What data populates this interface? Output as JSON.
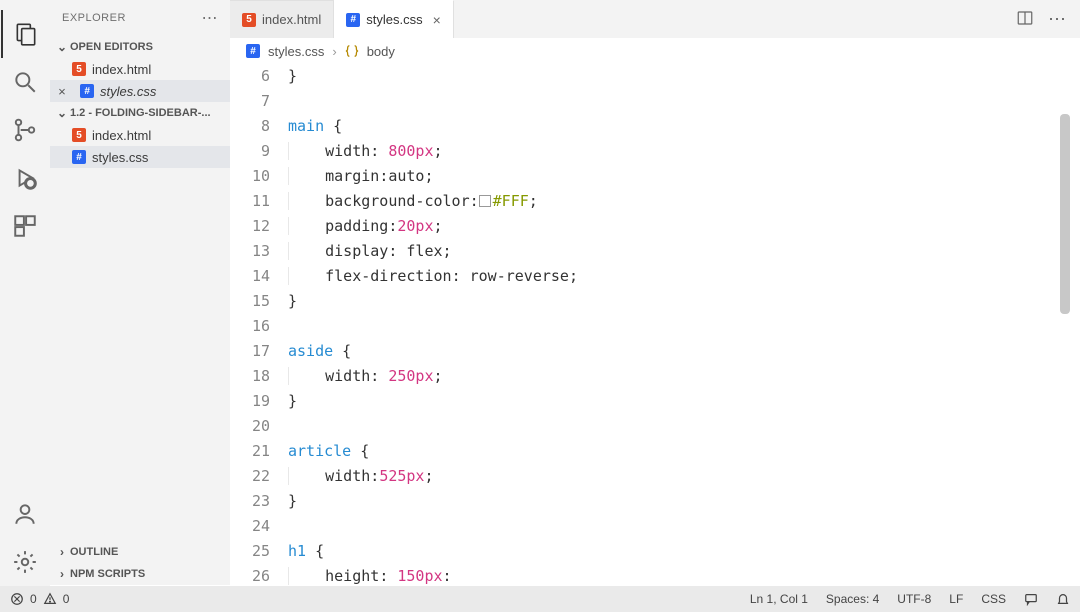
{
  "sidebar": {
    "title": "EXPLORER",
    "openEditors": {
      "label": "OPEN EDITORS",
      "items": [
        {
          "name": "index.html",
          "type": "html",
          "dirty": false,
          "active": false
        },
        {
          "name": "styles.css",
          "type": "css",
          "dirty": true,
          "active": true
        }
      ]
    },
    "workspace": {
      "label": "1.2 - FOLDING-SIDEBAR-...",
      "items": [
        {
          "name": "index.html",
          "type": "html",
          "active": false
        },
        {
          "name": "styles.css",
          "type": "css",
          "active": true
        }
      ]
    },
    "outline": "OUTLINE",
    "npmScripts": "NPM SCRIPTS"
  },
  "tabs": [
    {
      "name": "index.html",
      "type": "html",
      "active": false,
      "closeable": false
    },
    {
      "name": "styles.css",
      "type": "css",
      "active": true,
      "closeable": true
    }
  ],
  "breadcrumb": {
    "file": "styles.css",
    "symbol": "body"
  },
  "editor": {
    "startLine": 6,
    "lines": [
      {
        "n": 6,
        "indent": 0,
        "tokens": [
          {
            "t": "}",
            "c": ""
          }
        ]
      },
      {
        "n": 7,
        "indent": 0,
        "tokens": []
      },
      {
        "n": 8,
        "indent": 0,
        "tokens": [
          {
            "t": "main",
            "c": "sel"
          },
          {
            "t": " {",
            "c": ""
          }
        ]
      },
      {
        "n": 9,
        "indent": 1,
        "tokens": [
          {
            "t": "width",
            "c": "prop"
          },
          {
            "t": ": ",
            "c": ""
          },
          {
            "t": "800px",
            "c": "num"
          },
          {
            "t": ";",
            "c": ""
          }
        ]
      },
      {
        "n": 10,
        "indent": 1,
        "tokens": [
          {
            "t": "margin",
            "c": "prop"
          },
          {
            "t": ":",
            "c": ""
          },
          {
            "t": "auto",
            "c": "kw"
          },
          {
            "t": ";",
            "c": ""
          }
        ]
      },
      {
        "n": 11,
        "indent": 1,
        "tokens": [
          {
            "t": "background-color",
            "c": "prop"
          },
          {
            "t": ":",
            "c": ""
          },
          {
            "t": "swatch",
            "c": "SW"
          },
          {
            "t": "#FFF",
            "c": "hex"
          },
          {
            "t": ";",
            "c": ""
          }
        ]
      },
      {
        "n": 12,
        "indent": 1,
        "tokens": [
          {
            "t": "padding",
            "c": "prop"
          },
          {
            "t": ":",
            "c": ""
          },
          {
            "t": "20px",
            "c": "num"
          },
          {
            "t": ";",
            "c": ""
          }
        ]
      },
      {
        "n": 13,
        "indent": 1,
        "tokens": [
          {
            "t": "display",
            "c": "prop"
          },
          {
            "t": ": ",
            "c": ""
          },
          {
            "t": "flex",
            "c": "kw"
          },
          {
            "t": ";",
            "c": ""
          }
        ]
      },
      {
        "n": 14,
        "indent": 1,
        "tokens": [
          {
            "t": "flex-direction",
            "c": "prop"
          },
          {
            "t": ": ",
            "c": ""
          },
          {
            "t": "row-reverse",
            "c": "kw"
          },
          {
            "t": ";",
            "c": ""
          }
        ]
      },
      {
        "n": 15,
        "indent": 0,
        "tokens": [
          {
            "t": "}",
            "c": ""
          }
        ]
      },
      {
        "n": 16,
        "indent": 0,
        "tokens": []
      },
      {
        "n": 17,
        "indent": 0,
        "tokens": [
          {
            "t": "aside",
            "c": "sel"
          },
          {
            "t": " {",
            "c": ""
          }
        ]
      },
      {
        "n": 18,
        "indent": 1,
        "tokens": [
          {
            "t": "width",
            "c": "prop"
          },
          {
            "t": ": ",
            "c": ""
          },
          {
            "t": "250px",
            "c": "num"
          },
          {
            "t": ";",
            "c": ""
          }
        ]
      },
      {
        "n": 19,
        "indent": 0,
        "tokens": [
          {
            "t": "}",
            "c": ""
          }
        ]
      },
      {
        "n": 20,
        "indent": 0,
        "tokens": []
      },
      {
        "n": 21,
        "indent": 0,
        "tokens": [
          {
            "t": "article",
            "c": "sel"
          },
          {
            "t": " {",
            "c": ""
          }
        ]
      },
      {
        "n": 22,
        "indent": 1,
        "tokens": [
          {
            "t": "width",
            "c": "prop"
          },
          {
            "t": ":",
            "c": ""
          },
          {
            "t": "525px",
            "c": "num"
          },
          {
            "t": ";",
            "c": ""
          }
        ]
      },
      {
        "n": 23,
        "indent": 0,
        "tokens": [
          {
            "t": "}",
            "c": ""
          }
        ]
      },
      {
        "n": 24,
        "indent": 0,
        "tokens": []
      },
      {
        "n": 25,
        "indent": 0,
        "tokens": [
          {
            "t": "h1",
            "c": "sel"
          },
          {
            "t": " {",
            "c": ""
          }
        ]
      },
      {
        "n": 26,
        "indent": 1,
        "tokens": [
          {
            "t": "height",
            "c": "prop"
          },
          {
            "t": ": ",
            "c": ""
          },
          {
            "t": "150px",
            "c": "num"
          },
          {
            "t": ":",
            "c": ""
          }
        ]
      }
    ]
  },
  "status": {
    "errors": "0",
    "warnings": "0",
    "position": "Ln 1, Col 1",
    "spaces": "Spaces: 4",
    "encoding": "UTF-8",
    "eol": "LF",
    "language": "CSS"
  },
  "icons": {
    "explorer": "explorer-icon",
    "search": "search-icon",
    "sourceControl": "source-control-icon",
    "debug": "debug-icon",
    "extensions": "extensions-icon",
    "account": "account-icon",
    "settings": "gear-icon",
    "splitEditor": "split-editor-icon",
    "more": "more-icon"
  }
}
